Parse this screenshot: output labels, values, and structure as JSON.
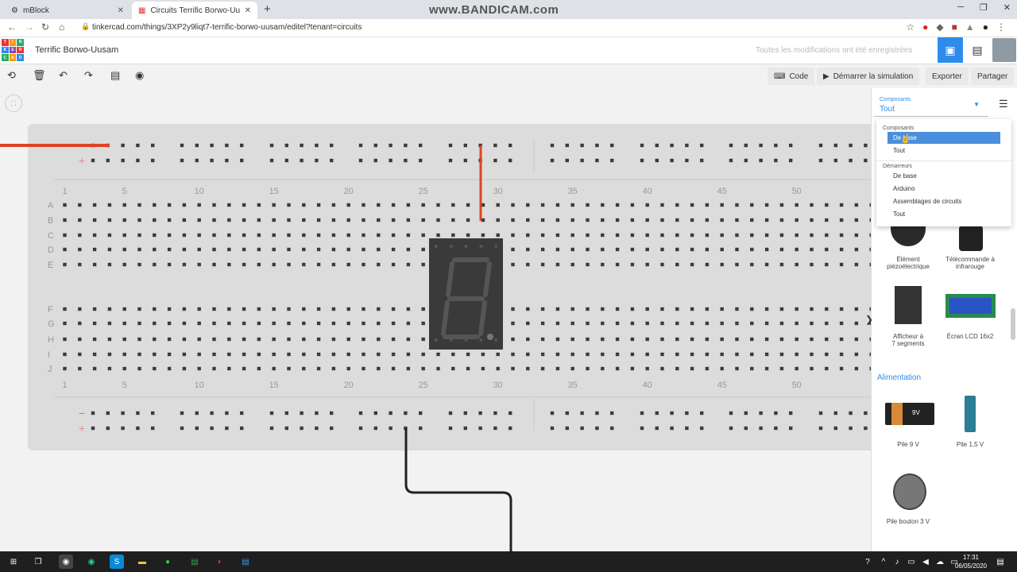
{
  "browser": {
    "tabs": [
      {
        "title": "mBlock",
        "icon": "mblock-icon",
        "active": false
      },
      {
        "title": "Circuits Terrific Borwo-Uusam | Ti",
        "icon": "tinkercad-icon",
        "active": true
      }
    ],
    "new_tab": "+",
    "url": "tinkercad.com/things/3XP2y9liqt7-terrific-borwo-uusam/editel?tenant=circuits",
    "watermark": "www.BANDICAM.com"
  },
  "app": {
    "logo_letters": [
      "T",
      "I",
      "N",
      "K",
      "E",
      "R",
      "C",
      "A",
      "D"
    ],
    "project_title": "Terrific Borwo-Uusam",
    "save_status": "Toutes les modifications ont été enregistrées"
  },
  "toolbar": {
    "code_label": "Code",
    "simulate_label": "Démarrer la simulation",
    "export_label": "Exporter",
    "share_label": "Partager"
  },
  "breadboard": {
    "column_numbers": [
      "1",
      "5",
      "10",
      "15",
      "20",
      "25",
      "30",
      "35",
      "40",
      "45",
      "50"
    ],
    "rows_top": [
      "A",
      "B",
      "C",
      "D",
      "E"
    ],
    "rows_bottom": [
      "F",
      "G",
      "H",
      "I",
      "J"
    ],
    "rail_minus": "−",
    "rail_plus": "+"
  },
  "panel": {
    "select_label": "Composants",
    "select_value": "Tout",
    "dropdown": {
      "group1_label": "Composants",
      "group1_items": [
        "De base",
        "Tout"
      ],
      "group2_label": "Démarreurs",
      "group2_items": [
        "De base",
        "Arduino",
        "Assemblages de circuits",
        "Tout"
      ]
    },
    "components": [
      {
        "label1": "Élément",
        "label2": "piézoélectrique"
      },
      {
        "label1": "Télécommande à",
        "label2": "infrarouge"
      },
      {
        "label1": "Afficheur à",
        "label2": "7 segments"
      },
      {
        "label1": "Écran LCD 16x2",
        "label2": ""
      }
    ],
    "section_power": "Alimentation",
    "power_components": [
      {
        "label": "Pile 9 V",
        "badge": "9V"
      },
      {
        "label": "Pile 1,5 V"
      },
      {
        "label": "Pile bouton 3 V"
      }
    ]
  },
  "taskbar": {
    "time": "17:31",
    "date": "06/05/2020"
  }
}
